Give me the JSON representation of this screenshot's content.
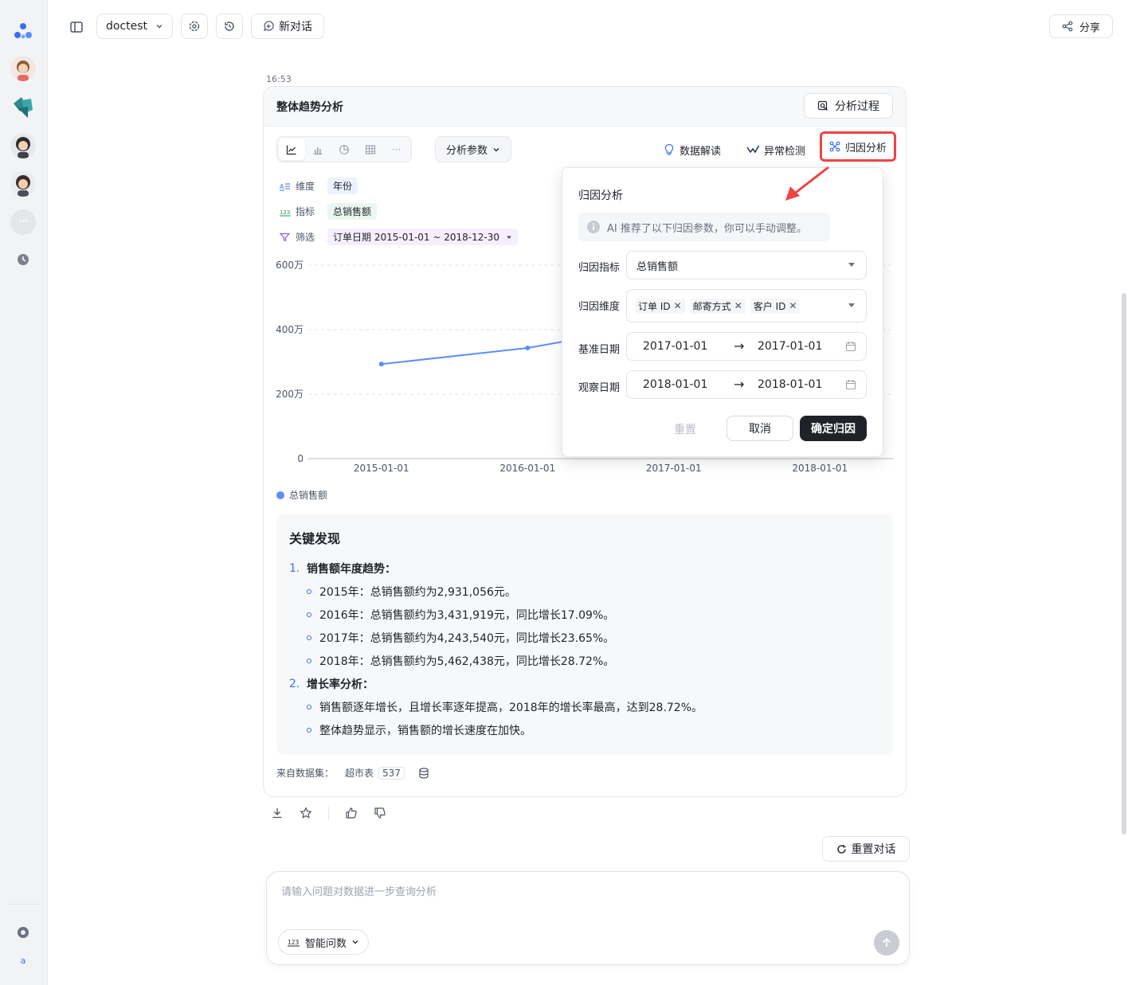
{
  "topbar": {
    "dataset_label": "doctest",
    "new_chat_label": "新对话",
    "share_label": "分享"
  },
  "sidebar": {
    "user_initial": "a"
  },
  "message": {
    "time": "16:53",
    "card_title": "整体趋势分析",
    "process_label": "分析过程",
    "param_label": "分析参数",
    "actions": {
      "interpret": "数据解读",
      "anomaly": "异常检测",
      "attribution": "归因分析"
    },
    "meta": {
      "dimension_label": "维度",
      "dimension_value": "年份",
      "metric_label": "指标",
      "metric_value": "总销售额",
      "filter_label": "筛选",
      "filter_value": "订单日期 2015-01-01 ~ 2018-12-30"
    },
    "legend_label": "总销售额",
    "findings": {
      "title": "关键发现",
      "sections": [
        {
          "num": "1.",
          "heading": "销售额年度趋势：",
          "items": [
            "2015年：总销售额约为2,931,056元。",
            "2016年：总销售额约为3,431,919元，同比增长17.09%。",
            "2017年：总销售额约为4,243,540元，同比增长23.65%。",
            "2018年：总销售额约为5,462,438元，同比增长28.72%。"
          ]
        },
        {
          "num": "2.",
          "heading": "增长率分析：",
          "items": [
            "销售额逐年增长，且增长率逐年提高，2018年的增长率最高，达到28.72%。",
            "整体趋势显示，销售额的增长速度在加快。"
          ]
        }
      ]
    },
    "source": {
      "label": "来自数据集：",
      "dataset": "超市表",
      "count": "537"
    }
  },
  "reset_conv_label": "重置对话",
  "composer": {
    "placeholder": "请输入问题对数据进一步查询分析",
    "mode_label": "智能问数"
  },
  "popup": {
    "title": "归因分析",
    "tip": "AI 推荐了以下归因参数，你可以手动调整。",
    "metric_label": "归因指标",
    "metric_value": "总销售额",
    "dims_label": "归因维度",
    "dims": [
      "订单 ID",
      "邮寄方式",
      "客户 ID"
    ],
    "base_label": "基准日期",
    "base_start": "2017-01-01",
    "base_end": "2017-01-01",
    "obs_label": "观察日期",
    "obs_start": "2018-01-01",
    "obs_end": "2018-01-01",
    "reset_label": "重置",
    "cancel_label": "取消",
    "ok_label": "确定归因"
  },
  "colors": {
    "series": "#5b8ff9",
    "highlight": "#f04444",
    "accent": "#3b6ef5"
  },
  "chart_data": {
    "type": "line",
    "x": [
      "2015-01-01",
      "2016-01-01",
      "2017-01-01",
      "2018-01-01"
    ],
    "y_ticks": [
      "0",
      "200万",
      "400万",
      "600万"
    ],
    "y_tick_values": [
      0,
      2000000,
      4000000,
      6000000
    ],
    "ylim": [
      0,
      6000000
    ],
    "grid": true,
    "legend_position": "bottom-left",
    "series": [
      {
        "name": "总销售额",
        "values": [
          2931056,
          3431919,
          4243540,
          5462438
        ]
      }
    ]
  }
}
